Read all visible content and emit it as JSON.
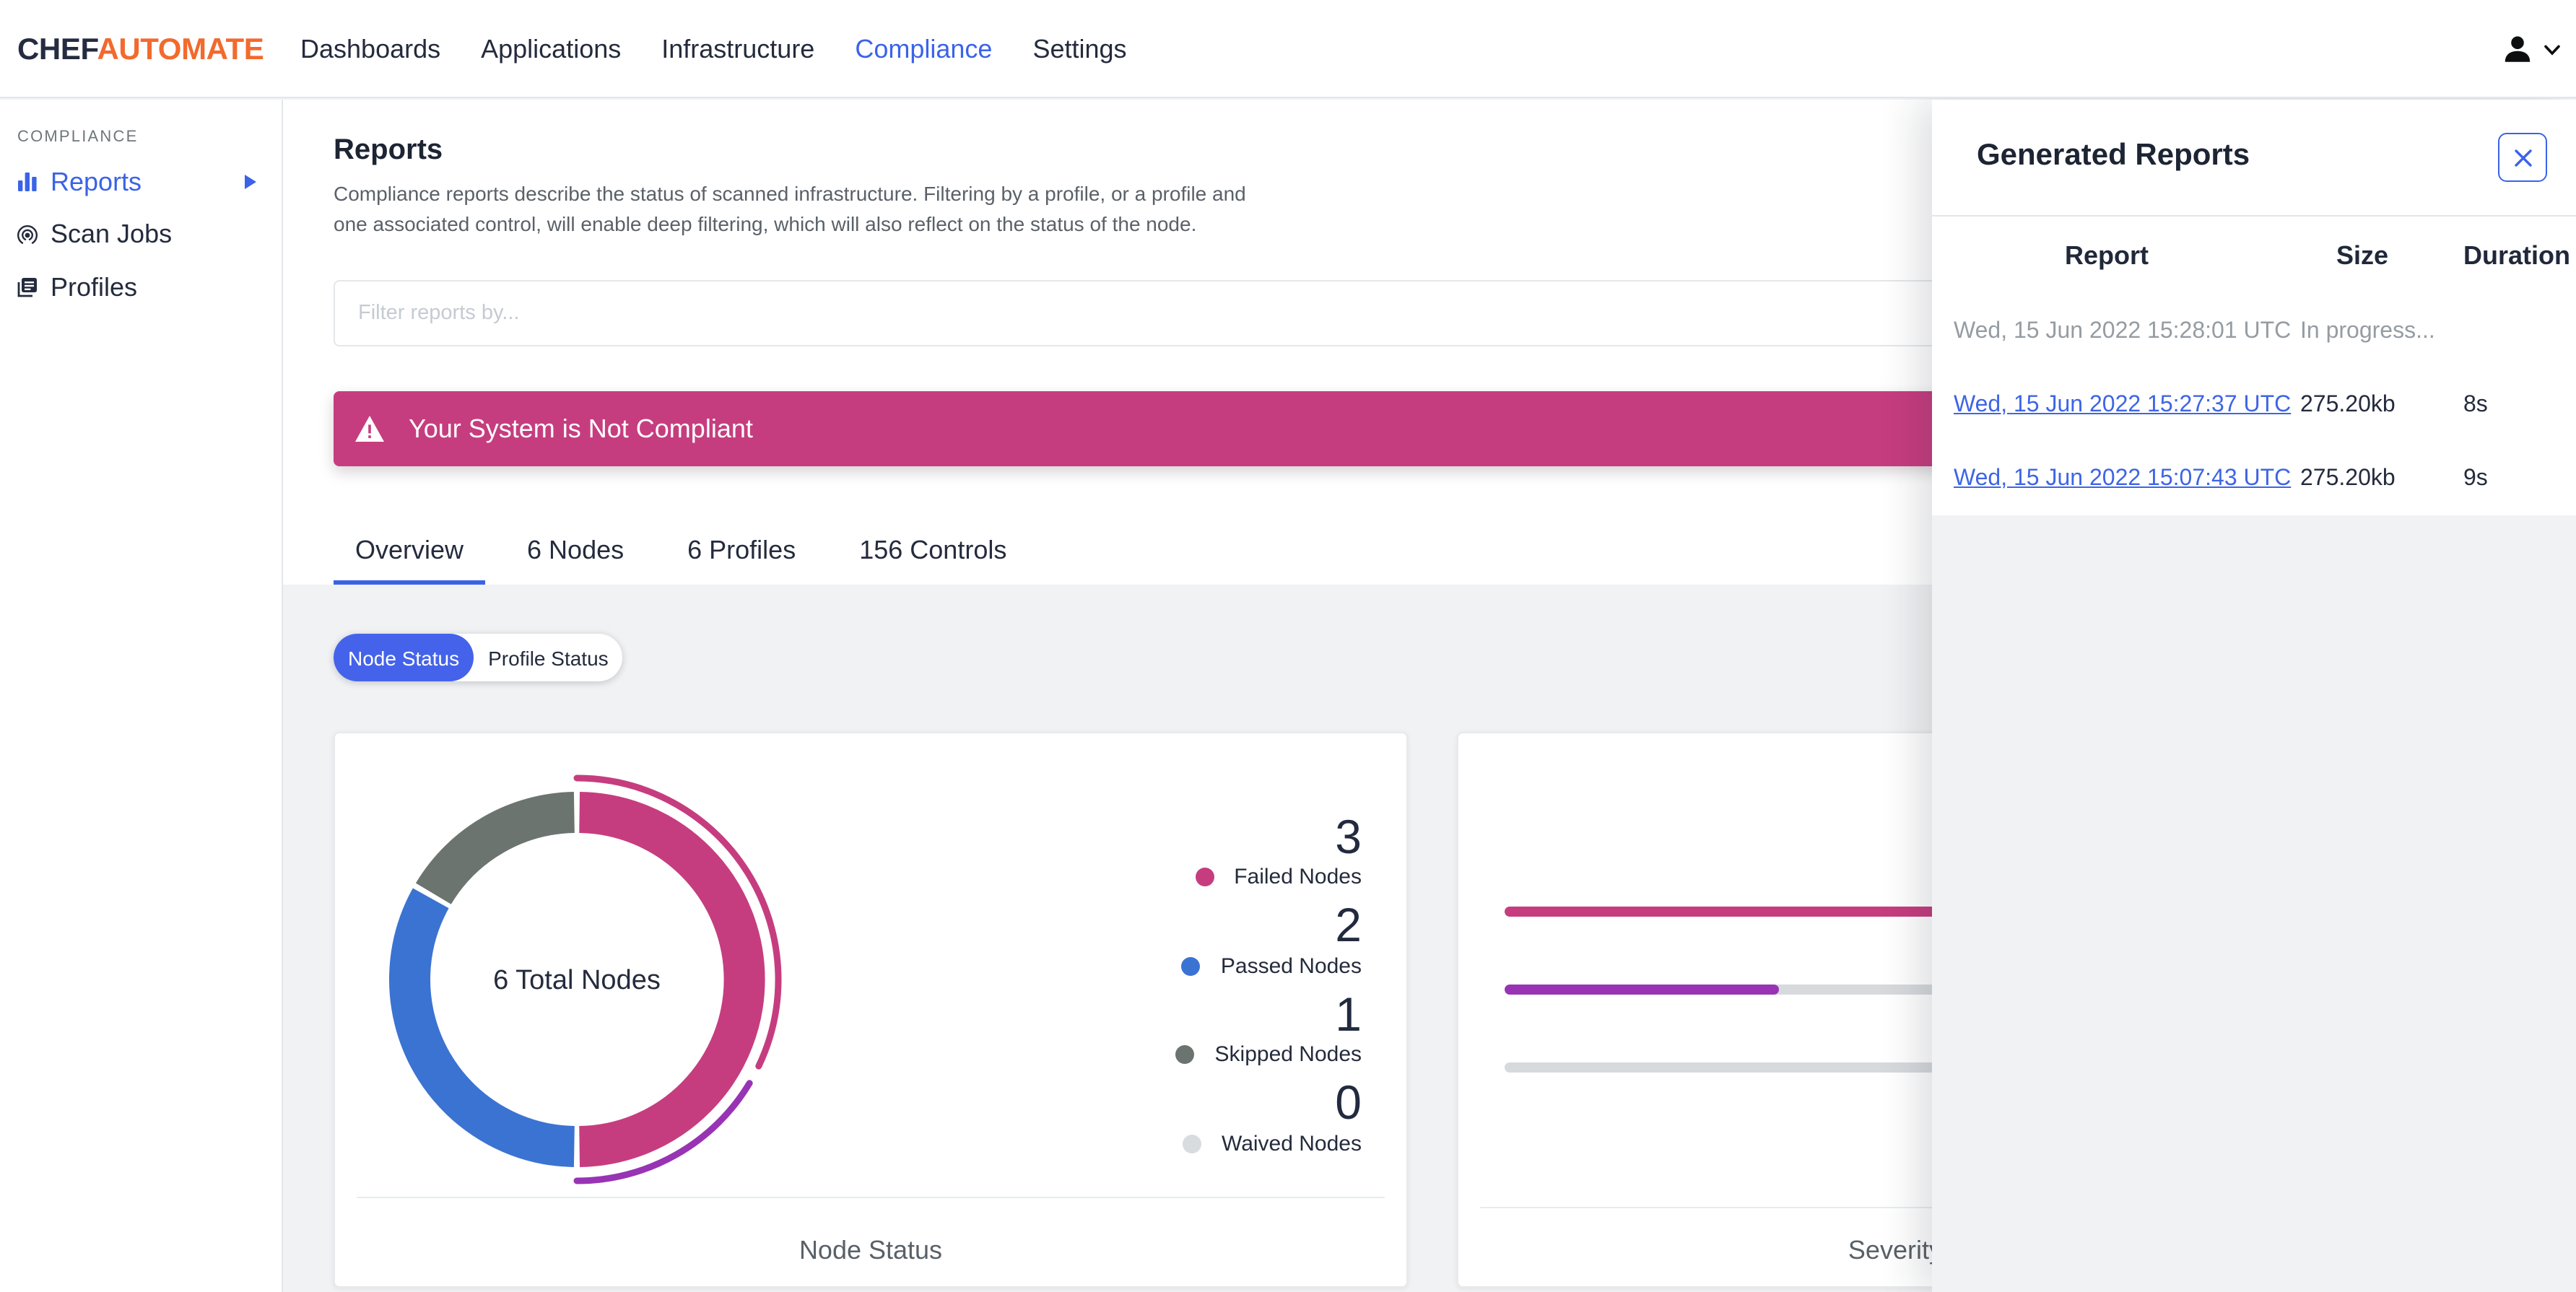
{
  "colors": {
    "accent_blue": "#3B63E8",
    "toggle_blue": "#4463EA",
    "banner_magenta": "#C63D7F",
    "failed_magenta": "#C63D7F",
    "passed_blue": "#3B73D3",
    "skipped_gray": "#6C7470",
    "waived_light_gray": "#D8DCDF",
    "purple": "#9834B4",
    "logo_orange": "#F26A2D"
  },
  "nav": {
    "logo_chef": "CHEF",
    "logo_automate": "AUTOMATE",
    "items": [
      {
        "label": "Dashboards"
      },
      {
        "label": "Applications"
      },
      {
        "label": "Infrastructure"
      },
      {
        "label": "Compliance",
        "active": true
      },
      {
        "label": "Settings"
      }
    ]
  },
  "sidebar": {
    "section_label": "COMPLIANCE",
    "items": [
      {
        "label": "Reports",
        "icon": "bar-chart-icon",
        "active": true
      },
      {
        "label": "Scan Jobs",
        "icon": "radar-icon"
      },
      {
        "label": "Profiles",
        "icon": "profiles-icon"
      }
    ]
  },
  "main": {
    "title": "Reports",
    "description_line1": "Compliance reports describe the status of scanned infrastructure. Filtering by a profile, or a profile and",
    "description_line2": "one associated control, will enable deep filtering, which will also reflect on the status of the node.",
    "filter_placeholder": "Filter reports by...",
    "banner_text": "Your System is Not Compliant",
    "tabs": [
      {
        "label": "Overview",
        "active": true
      },
      {
        "label": "6 Nodes"
      },
      {
        "label": "6 Profiles"
      },
      {
        "label": "156 Controls"
      }
    ],
    "toggle": {
      "node_status": "Node Status",
      "profile_status": "Profile Status"
    }
  },
  "node_status_card": {
    "center_label": "6 Total Nodes",
    "footer_label": "Node Status",
    "legend": [
      {
        "value": "3",
        "label": "Failed Nodes"
      },
      {
        "value": "2",
        "label": "Passed Nodes"
      },
      {
        "value": "1",
        "label": "Skipped Nodes"
      },
      {
        "value": "0",
        "label": "Waived Nodes"
      }
    ]
  },
  "severity_card": {
    "footer_label": "Severity of Node Failures"
  },
  "panel": {
    "title": "Generated Reports",
    "columns": [
      "Report",
      "Size",
      "Duration"
    ],
    "rows": [
      {
        "report": "Wed, 15 Jun 2022 15:28:01 UTC",
        "size": "In progress...",
        "duration": "",
        "state": "in-progress"
      },
      {
        "report": "Wed, 15 Jun 2022 15:27:37 UTC",
        "size": "275.20kb",
        "duration": "8s",
        "state": "link"
      },
      {
        "report": "Wed, 15 Jun 2022 15:07:43 UTC",
        "size": "275.20kb",
        "duration": "9s",
        "state": "link"
      }
    ]
  },
  "chart_data": [
    {
      "type": "pie",
      "title": "Node Status",
      "center_label": "6 Total Nodes",
      "total": 6,
      "segments": [
        {
          "label": "Failed Nodes",
          "value": 3,
          "color": "#C63D7F"
        },
        {
          "label": "Passed Nodes",
          "value": 2,
          "color": "#3B73D3"
        },
        {
          "label": "Skipped Nodes",
          "value": 1,
          "color": "#6C7470"
        },
        {
          "label": "Waived Nodes",
          "value": 0,
          "color": "#D8DCDF"
        }
      ],
      "outer_arcs": [
        {
          "start_deg": 0,
          "end_deg": 115.5,
          "color": "#C63D7F"
        },
        {
          "start_deg": 121,
          "end_deg": 180,
          "color": "#9834B4"
        }
      ]
    },
    {
      "type": "bar",
      "title": "Severity of Node Failures",
      "orientation": "horizontal",
      "track_color": "#D7DADD",
      "bars": [
        {
          "color": "#C63D7F",
          "fill_pct": 100
        },
        {
          "color": "#9834B4",
          "fill_pct": 28
        },
        {
          "color": "#D7DADD",
          "fill_pct": 0
        }
      ]
    }
  ]
}
